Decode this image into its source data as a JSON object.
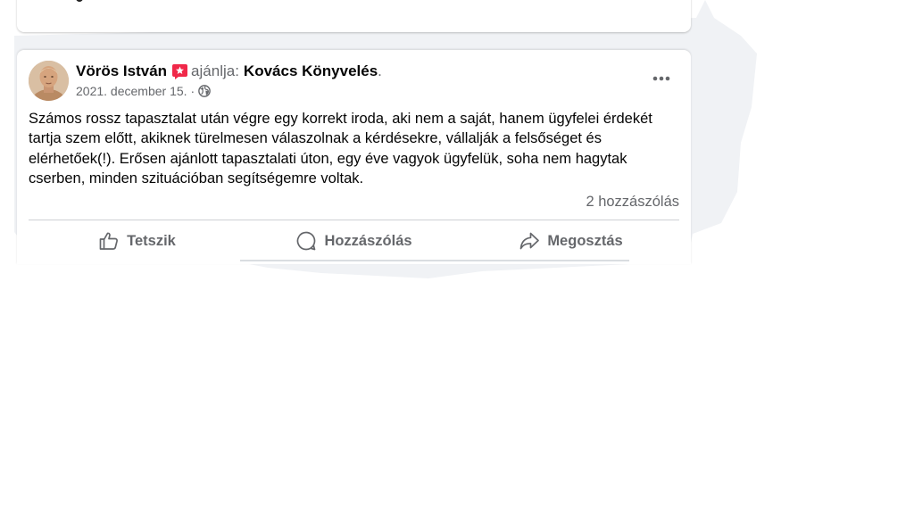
{
  "post": {
    "author": "Vörös István",
    "recommends_text": "ajánlja:",
    "page_name": "Kovács Könyvelés",
    "page_name_suffix": ".",
    "date": "2021. december 15.",
    "date_separator": "·",
    "privacy_icon": "globe-icon",
    "more_icon": "more-options-icon",
    "body": "Számos rossz tapasztalat után végre egy korrekt iroda, aki nem a saját, hanem ügyfelei érdekét tartja szem előtt, akiknek türelmesen válaszolnak a kérdésekre, vállalják a felsőséget és elérhetőek(!). Erősen ajánlott tapasztalati úton, egy éve vagyok ügyfelük, soha nem hagytak cserben, minden szituációban segítségemre voltak.",
    "comments_count": "2 hozzászólás"
  },
  "actions": {
    "like_label": "Tetszik",
    "comment_label": "Hozzászólás",
    "share_label": "Megosztás"
  },
  "colors": {
    "recommend_badge": "#f02849",
    "secondary_text": "#65676b",
    "divider": "#ced0d4",
    "backdrop": "#f0f2f5"
  }
}
